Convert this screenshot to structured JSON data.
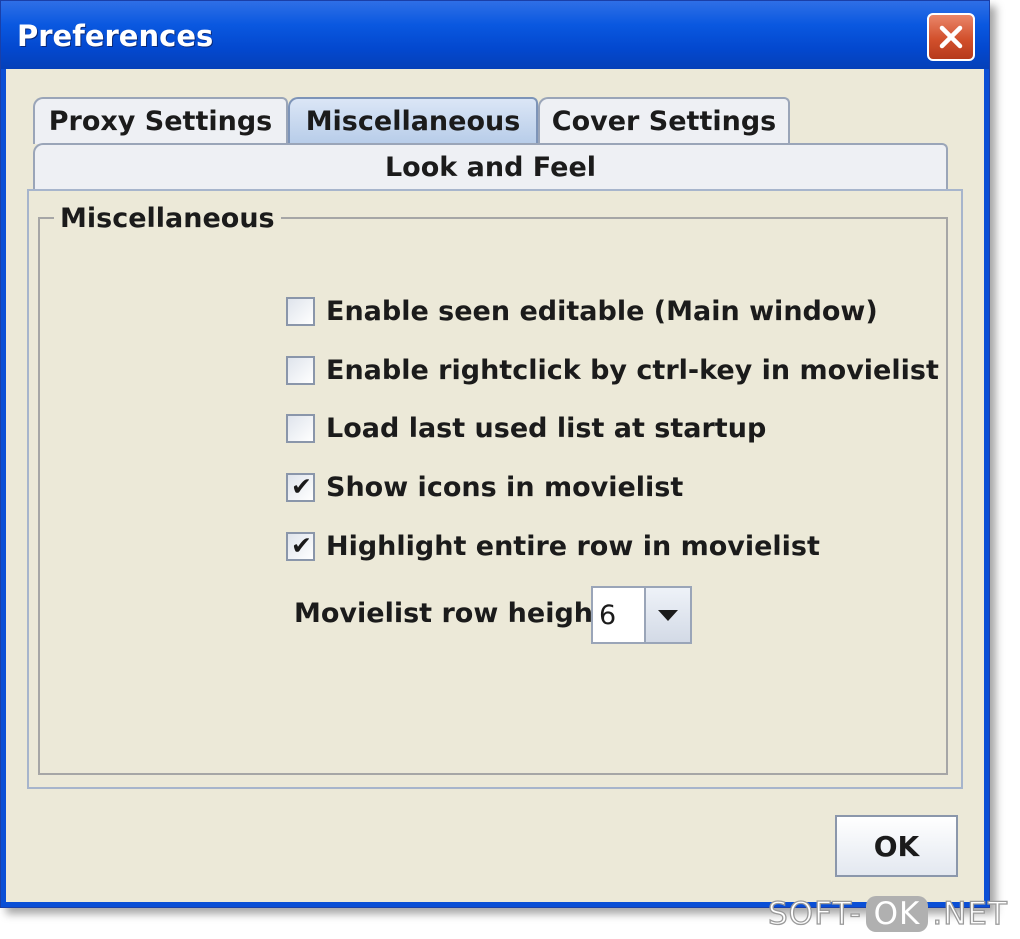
{
  "window": {
    "title": "Preferences"
  },
  "tabs": [
    {
      "label": "Proxy Settings",
      "selected": false
    },
    {
      "label": "Miscellaneous",
      "selected": true
    },
    {
      "label": "Cover Settings",
      "selected": false
    },
    {
      "label": "Look and Feel",
      "selected": false
    }
  ],
  "group": {
    "title": "Miscellaneous",
    "options": [
      {
        "label": "Enable seen editable (Main window)",
        "checked": false
      },
      {
        "label": "Enable rightclick by ctrl-key in movielist",
        "checked": false
      },
      {
        "label": "Load last used list at startup",
        "checked": false
      },
      {
        "label": "Show icons in movielist",
        "checked": true
      },
      {
        "label": "Highlight entire row in movielist",
        "checked": true
      }
    ],
    "row_height": {
      "label": "Movielist row height:",
      "value": "6"
    }
  },
  "ok_label": "OK",
  "watermark": {
    "part1": "SOFT-",
    "part2": "OK",
    "part3": ".NET"
  },
  "colors": {
    "title_bar": "#0a58e0",
    "close_button": "#d2502c",
    "window_bg": "#ece9d8"
  }
}
